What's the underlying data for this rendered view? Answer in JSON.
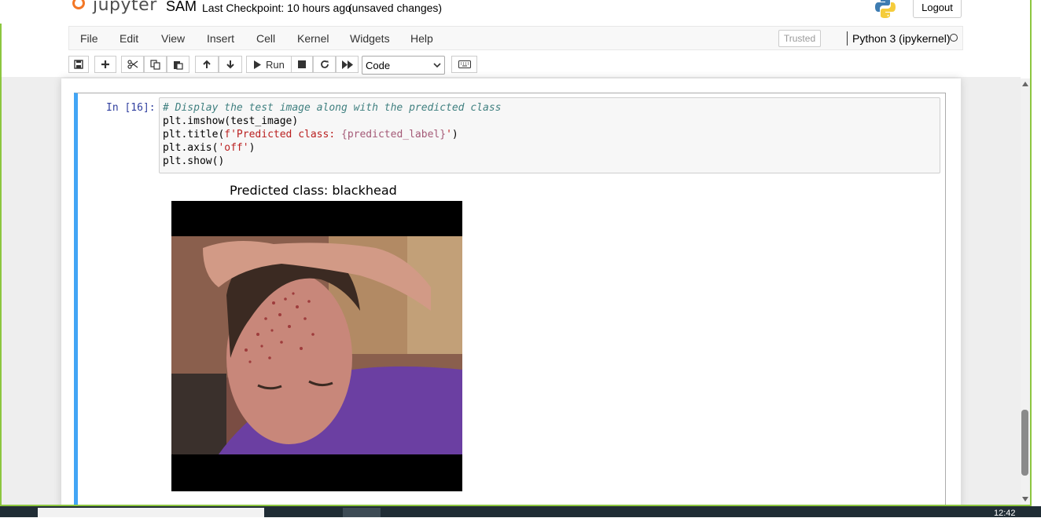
{
  "header": {
    "logo_text": "jupyter",
    "notebook_name": "SAM",
    "checkpoint": "Last Checkpoint: 10 hours ago",
    "unsaved": "(unsaved changes)",
    "logout_label": "Logout"
  },
  "menubar": {
    "items": [
      "File",
      "Edit",
      "View",
      "Insert",
      "Cell",
      "Kernel",
      "Widgets",
      "Help"
    ],
    "trusted_label": "Trusted",
    "kernel_name": "Python 3 (ipykernel)"
  },
  "toolbar": {
    "run_label": "Run",
    "cell_type_value": "Code"
  },
  "cell": {
    "prompt": "In [16]:",
    "code": {
      "line1": "# Display the test image along with the predicted class",
      "line2": "plt.imshow(test_image)",
      "line3_prefix": "plt.title(",
      "line3_str1": "f'Predicted class: ",
      "line3_interp": "{predicted_label}",
      "line3_str2": "'",
      "line3_suffix": ")",
      "line4_prefix": "plt.axis(",
      "line4_str": "'off'",
      "line4_suffix": ")",
      "line5": "plt.show()"
    },
    "output_title": "Predicted class: blackhead"
  },
  "taskbar": {
    "clock": "12:42"
  },
  "colors": {
    "cell_selected_border": "#42a5f5",
    "frame_green": "#8cc63f",
    "prompt_blue": "#303f9f"
  }
}
